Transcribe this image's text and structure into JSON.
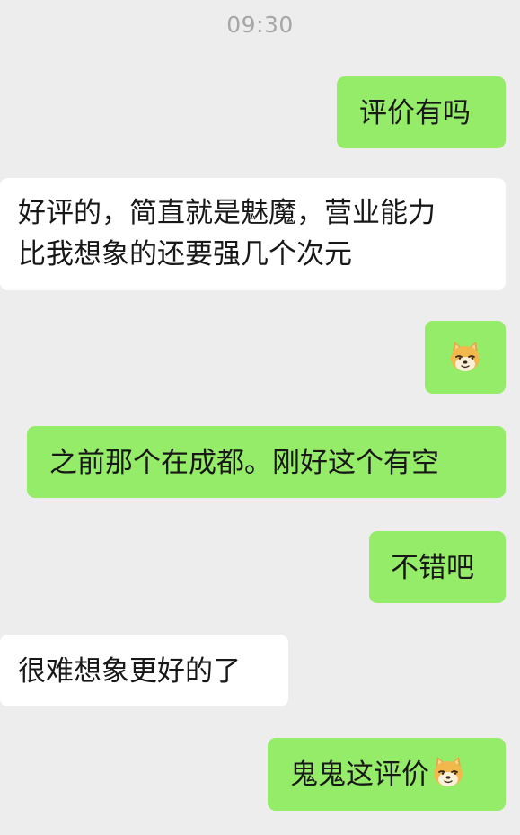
{
  "chat": {
    "timestamp": "09:30",
    "colors": {
      "background": "#ededed",
      "sent_bubble": "#95ec69",
      "received_bubble": "#ffffff",
      "timestamp_text": "#a6a6a6"
    },
    "messages": [
      {
        "from": "me",
        "text": "评价有吗"
      },
      {
        "from": "other",
        "lines": [
          "好评的，简直就是魅魔，营业能力",
          "比我想象的还要强几个次元"
        ]
      },
      {
        "from": "me",
        "emoji": "doge-emoji"
      },
      {
        "from": "me",
        "text": "之前那个在成都。刚好这个有空"
      },
      {
        "from": "me",
        "text": "不错吧"
      },
      {
        "from": "other",
        "text": "很难想象更好的了"
      },
      {
        "from": "me",
        "text": "鬼鬼这评价",
        "emoji": "doge-emoji"
      }
    ]
  }
}
